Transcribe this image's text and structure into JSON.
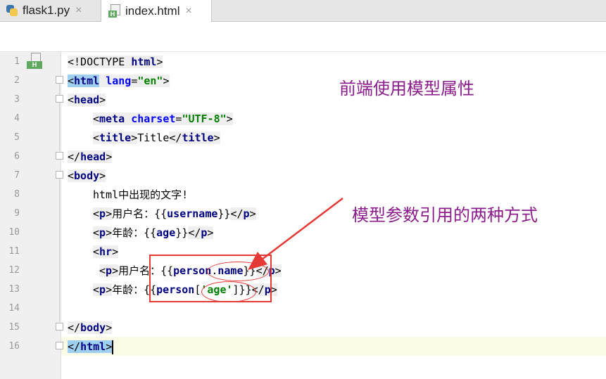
{
  "tabs": [
    {
      "label": "flask1.py",
      "close": "×",
      "icon": "python-file-icon"
    },
    {
      "label": "index.html",
      "close": "×",
      "icon": "html-file-icon",
      "active": true
    }
  ],
  "gutter_badge": "H",
  "lines": [
    "1",
    "2",
    "3",
    "4",
    "5",
    "6",
    "7",
    "8",
    "9",
    "10",
    "11",
    "12",
    "13",
    "14",
    "15",
    "16"
  ],
  "code": {
    "l1_doctype": "<!DOCTYPE ",
    "l1_html": "html",
    "l1_close": ">",
    "l2_lt": "<",
    "l2_html": "html",
    "l2_attr": "lang",
    "l2_eq": "=",
    "l2_val": "\"en\"",
    "l2_gt": ">",
    "l3_lt": "<",
    "l3_head": "head",
    "l3_gt": ">",
    "l4_lt": "<",
    "l4_meta": "meta",
    "l4_attr": "charset",
    "l4_eq": "=",
    "l4_val": "\"UTF-8\"",
    "l4_gt": ">",
    "l5_open": "<",
    "l5_title": "title",
    "l5_gt": ">",
    "l5_text": "Title",
    "l5_close_lt": "</",
    "l5_close_title": "title",
    "l5_close_gt": ">",
    "l6_lt": "</",
    "l6_head": "head",
    "l6_gt": ">",
    "l7_lt": "<",
    "l7_body": "body",
    "l7_gt": ">",
    "l8_text": "html中出现的文字!",
    "l9_p_lt": "<",
    "l9_p": "p",
    "l9_p_gt": ">",
    "l9_text": "用户名：{{",
    "l9_var": "username",
    "l9_end": "}}",
    "l9_cp_lt": "</",
    "l9_cp": "p",
    "l9_cp_gt": ">",
    "l10_p_lt": "<",
    "l10_p": "p",
    "l10_p_gt": ">",
    "l10_text": "年龄：{{",
    "l10_var": "age",
    "l10_end": "}}",
    "l10_cp_lt": "</",
    "l10_cp": "p",
    "l10_cp_gt": ">",
    "l11_lt": "<",
    "l11_hr": "hr",
    "l11_gt": ">",
    "l12_p_lt": "<",
    "l12_p": "p",
    "l12_p_gt": ">",
    "l12_text": "用户名：{{",
    "l12_var1": "person",
    "l12_dot": ".",
    "l12_var2": "name",
    "l12_end": "}}",
    "l12_cp_lt": "</",
    "l12_cp": "p",
    "l12_cp_gt": ">",
    "l13_p_lt": "<",
    "l13_p": "p",
    "l13_p_gt": ">",
    "l13_text": "年龄：{{",
    "l13_var": "person",
    "l13_br": "[",
    "l13_key": "'age'",
    "l13_br2": "]",
    "l13_end": "}}",
    "l13_cp_lt": "</",
    "l13_cp": "p",
    "l13_cp_gt": ">",
    "l15_lt": "</",
    "l15_body": "body",
    "l15_gt": ">",
    "l16_lt": "</",
    "l16_html": "html",
    "l16_gt": ">"
  },
  "annotations": {
    "top": "前端使用模型属性",
    "middle": "模型参数引用的两种方式"
  },
  "colors": {
    "annotation": "#8b1c8b",
    "marker": "#e53935",
    "tag_name": "#000080",
    "attr_name": "#0000ff",
    "attr_value": "#008000"
  }
}
